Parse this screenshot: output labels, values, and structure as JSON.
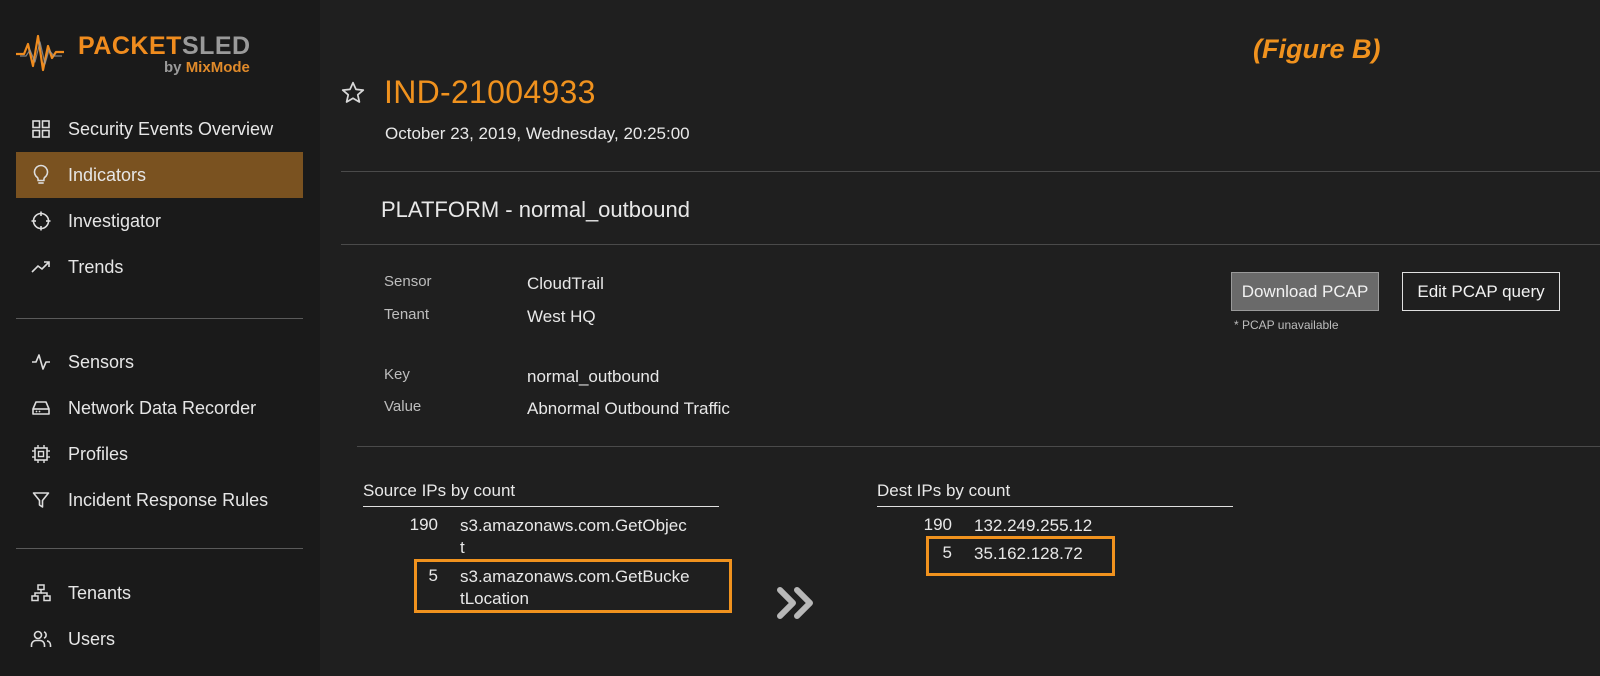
{
  "brand": {
    "name_part1": "PACKET",
    "name_part2": "SLED",
    "by": "by ",
    "by_brand": "MixMode"
  },
  "figure_label": "(Figure B)",
  "sidebar": {
    "group1": [
      {
        "label": "Security Events Overview",
        "icon": "grid-icon"
      },
      {
        "label": "Indicators",
        "icon": "lightbulb-icon",
        "active": true
      },
      {
        "label": "Investigator",
        "icon": "crosshair-icon"
      },
      {
        "label": "Trends",
        "icon": "trend-icon"
      }
    ],
    "group2": [
      {
        "label": "Sensors",
        "icon": "pulse-icon"
      },
      {
        "label": "Network Data Recorder",
        "icon": "drive-icon"
      },
      {
        "label": "Profiles",
        "icon": "chip-icon"
      },
      {
        "label": "Incident Response Rules",
        "icon": "filter-icon"
      }
    ],
    "group3": [
      {
        "label": "Tenants",
        "icon": "hierarchy-icon"
      },
      {
        "label": "Users",
        "icon": "users-icon"
      }
    ]
  },
  "indicator": {
    "id": "IND-21004933",
    "timestamp": "October 23, 2019, Wednesday, 20:25:00",
    "section_title": "PLATFORM - normal_outbound"
  },
  "details": {
    "sensor_key": "Sensor",
    "sensor_val": "CloudTrail",
    "tenant_key": "Tenant",
    "tenant_val": "West HQ",
    "key_key": "Key",
    "key_val": "normal_outbound",
    "value_key": "Value",
    "value_val": "Abnormal Outbound Traffic"
  },
  "actions": {
    "download_label": "Download PCAP",
    "edit_label": "Edit PCAP query",
    "note": "* PCAP unavailable"
  },
  "source_ips": {
    "title": "Source IPs by count",
    "rows": [
      {
        "count": "190",
        "line1": "s3.amazonaws.com.GetObjec",
        "line2": "t"
      },
      {
        "count": "5",
        "line1": "s3.amazonaws.com.GetBucke",
        "line2": "tLocation"
      }
    ]
  },
  "dest_ips": {
    "title": "Dest IPs by count",
    "rows": [
      {
        "count": "190",
        "value": "132.249.255.12"
      },
      {
        "count": "5",
        "value": "35.162.128.72"
      }
    ]
  },
  "colors": {
    "accent": "#f0921e",
    "active_nav": "#7a5220",
    "background": "#1f1f1f"
  }
}
